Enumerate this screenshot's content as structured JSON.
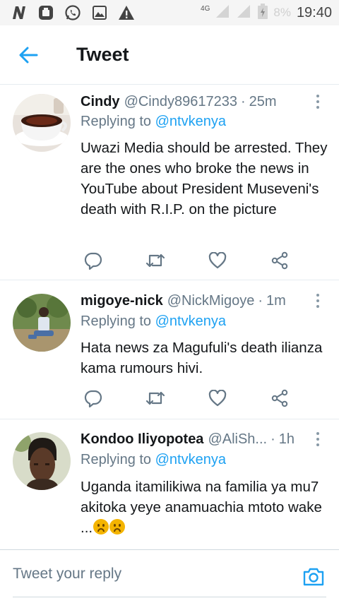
{
  "status_bar": {
    "network": "4G",
    "battery": "8%",
    "time": "19:40",
    "left_icons": [
      "n-app-icon",
      "message-icon",
      "whatsapp-icon",
      "image-icon",
      "warning-icon"
    ]
  },
  "header": {
    "title": "Tweet"
  },
  "tweets": [
    {
      "name": "Cindy",
      "handle": "@Cindy89617233",
      "time": "25m",
      "replying_prefix": "Replying to ",
      "replying_to": "@ntvkenya",
      "text": "Uwazi Media should be arrested. They are the ones who broke the news in YouTube about President Museveni's death with R.I.P. on the picture"
    },
    {
      "name": "migoye-nick",
      "handle": "@NickMigoye",
      "time": "1m",
      "replying_prefix": "Replying to ",
      "replying_to": "@ntvkenya",
      "text": "Hata news za Magufuli's death ilianza kama rumours hivi."
    },
    {
      "name": "Kondoo Iliyopotea",
      "handle": "@AliSh...",
      "time": "1h",
      "replying_prefix": "Replying to ",
      "replying_to": "@ntvkenya",
      "text": "Uganda itamilikiwa na familia ya mu7 akitoka yeye anamuachia mtoto wake ..."
    }
  ],
  "separator": "·",
  "reply_bar": {
    "placeholder": "Tweet your reply"
  },
  "colors": {
    "accent": "#1da1f2",
    "secondary_text": "#657786",
    "icon": "#657786"
  }
}
